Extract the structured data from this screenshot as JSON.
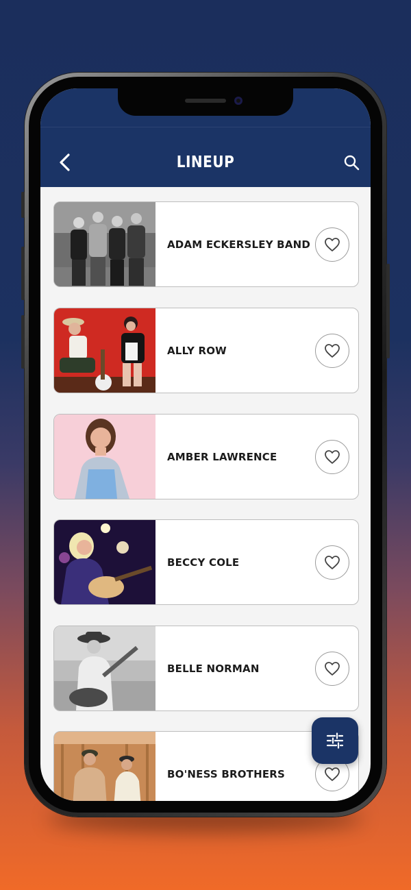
{
  "header": {
    "title": "LINEUP",
    "back_icon": "chevron-left-icon",
    "search_icon": "search-icon",
    "background": "#1b3466"
  },
  "lineup": [
    {
      "name": "ADAM ECKERSLEY BAND",
      "favorited": false
    },
    {
      "name": "ALLY ROW",
      "favorited": false
    },
    {
      "name": "AMBER LAWRENCE",
      "favorited": false
    },
    {
      "name": "BECCY COLE",
      "favorited": false
    },
    {
      "name": "BELLE NORMAN",
      "favorited": false
    },
    {
      "name": "BO'NESS BROTHERS",
      "favorited": false
    }
  ],
  "filter_button": {
    "icon": "sliders-icon"
  },
  "colors": {
    "accent": "#1b3466",
    "card_border": "#bdbdbd",
    "gradient_top": "#1b2e5c",
    "gradient_bottom": "#f06a28"
  }
}
